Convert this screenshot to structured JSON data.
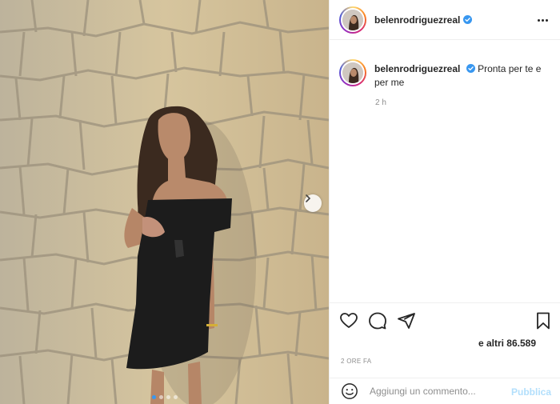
{
  "post": {
    "username": "belenrodriguezreal",
    "caption": "Pronta per te e per me",
    "comment_time": "2 h",
    "likes_text": "e altri 86.589",
    "date_label": "2 ORE FA"
  },
  "icons": {
    "verified": "verified-badge-icon",
    "more": "more-options-icon",
    "next": "chevron-right-icon",
    "like": "heart-icon",
    "comment": "comment-bubble-icon",
    "share": "paper-plane-icon",
    "save": "bookmark-icon",
    "emoji": "smiley-icon"
  },
  "comment_box": {
    "placeholder": "Aggiungi un commento...",
    "publish_label": "Pubblica"
  },
  "carousel": {
    "slide_count": 4,
    "active_index": 0
  },
  "colors": {
    "verified_blue": "#3897f0",
    "publish_disabled": "#b2dffc"
  }
}
